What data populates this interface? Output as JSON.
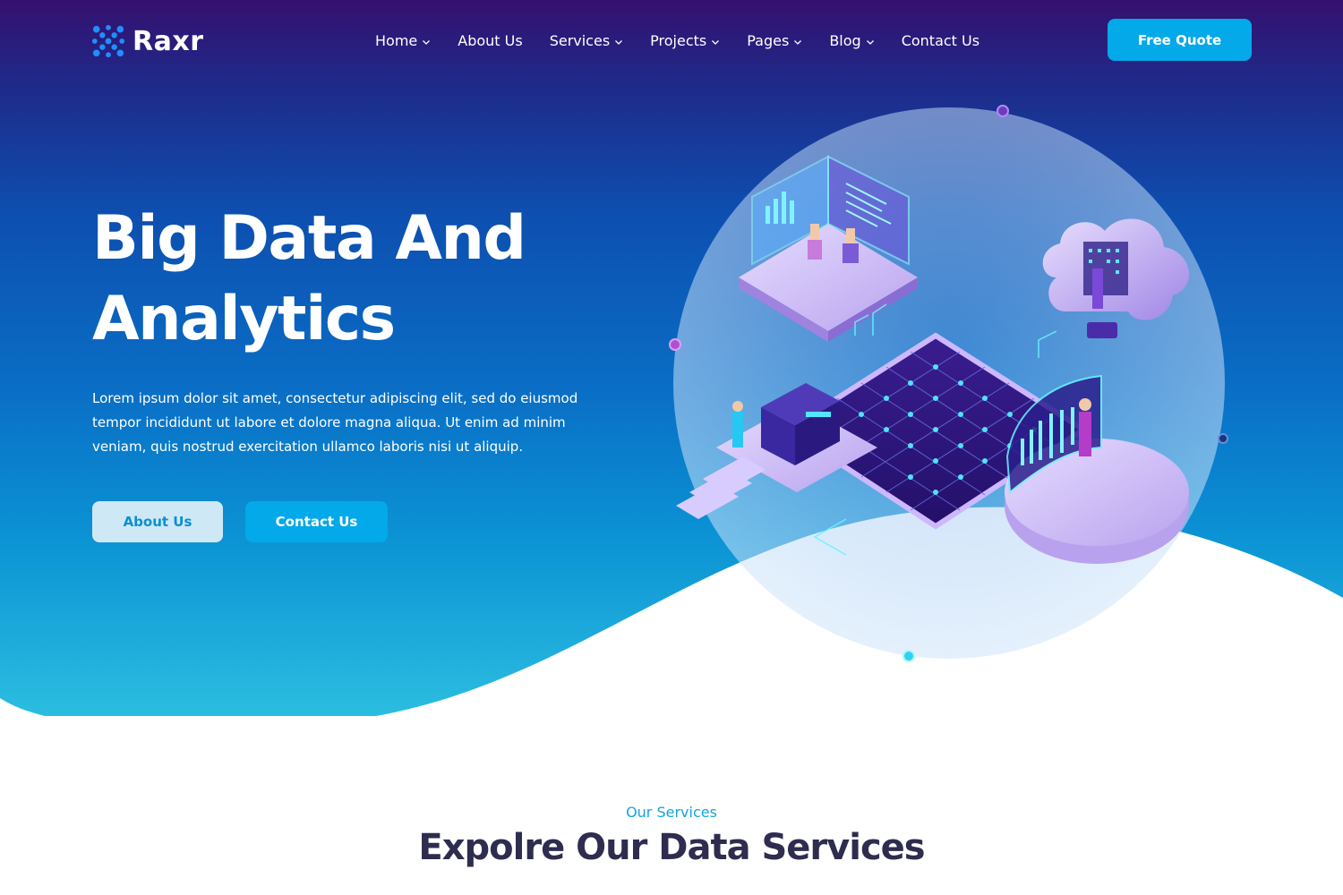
{
  "brand": {
    "name": "Raxr",
    "logo_icon": "molecule-x-icon",
    "accent": "#03a9e8"
  },
  "nav": {
    "items": [
      {
        "label": "Home",
        "has_dropdown": true
      },
      {
        "label": "About Us",
        "has_dropdown": false
      },
      {
        "label": "Services",
        "has_dropdown": true
      },
      {
        "label": "Projects",
        "has_dropdown": true
      },
      {
        "label": "Pages",
        "has_dropdown": true
      },
      {
        "label": "Blog",
        "has_dropdown": true
      },
      {
        "label": "Contact Us",
        "has_dropdown": false
      }
    ],
    "cta_label": "Free Quote"
  },
  "hero": {
    "title_line1": "Big Data And",
    "title_line2": "Analytics",
    "description": "Lorem ipsum dolor sit amet, consectetur adipiscing elit, sed do eiusmod tempor incididunt ut labore et dolore magna aliqua. Ut enim ad minim veniam, quis nostrud exercitation ullamco laboris nisi ut aliquip.",
    "primary_button": "About Us",
    "secondary_button": "Contact Us",
    "illustration": "isometric-data-center-illustration"
  },
  "services": {
    "kicker": "Our Services",
    "title": "Expolre Our Data Services"
  }
}
